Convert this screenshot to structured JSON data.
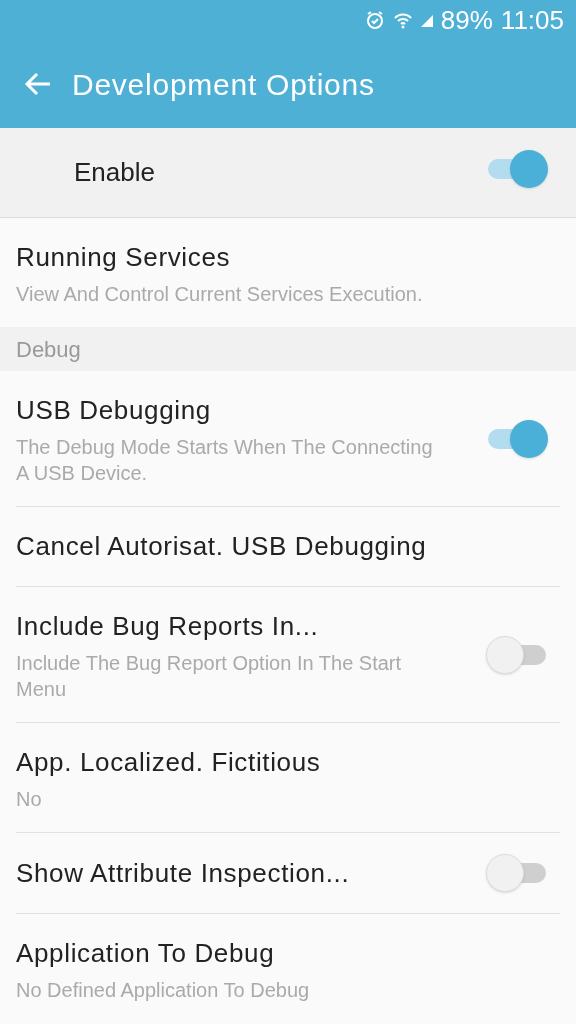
{
  "status_bar": {
    "battery": "89%",
    "time": "11:05"
  },
  "toolbar": {
    "title": "Development Options"
  },
  "master_switch": {
    "label": "Enable",
    "on": true
  },
  "items": [
    {
      "kind": "plain",
      "title": "Running Services",
      "summary": "View And Control Current Services Execution."
    },
    {
      "kind": "header",
      "title": "Debug"
    },
    {
      "kind": "toggle",
      "title": "USB Debugging",
      "summary": "The Debug Mode Starts When The Connecting A USB Device.",
      "on": true
    },
    {
      "kind": "plain",
      "title": "Cancel Autorisat. USB Debugging"
    },
    {
      "kind": "toggle",
      "title": "Include Bug Reports In...",
      "summary": "Include The Bug Report Option In The Start Menu",
      "on": false
    },
    {
      "kind": "plain",
      "title": "App. Localized. Fictitious",
      "summary": "No"
    },
    {
      "kind": "toggle",
      "title": "Show Attribute Inspection...",
      "on": false
    },
    {
      "kind": "plain",
      "title": "Application To Debug",
      "summary": "No Defined Application To Debug"
    }
  ]
}
